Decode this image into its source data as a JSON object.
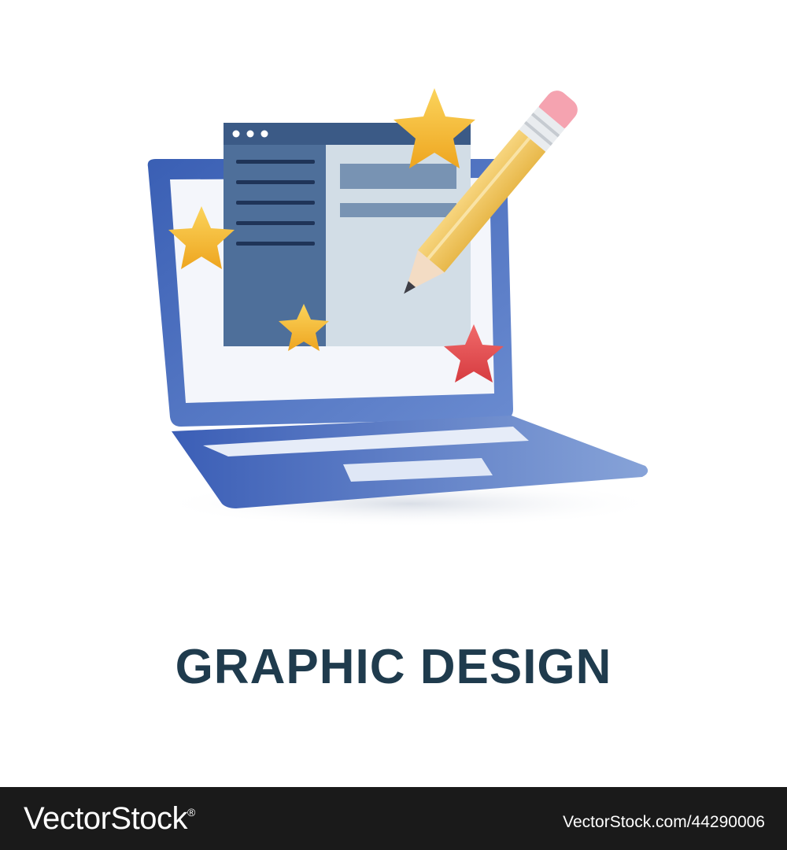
{
  "caption": {
    "title": "GRAPHIC DESIGN"
  },
  "footer": {
    "brand": "VectorStock",
    "brand_mark": "®",
    "image_ref": "VectorStock.com/44290006"
  },
  "illustration": {
    "icons": [
      "laptop-icon",
      "browser-window-icon",
      "pencil-icon",
      "star-icon"
    ],
    "colors": {
      "laptop_blue": "#3f64b8",
      "window_dark": "#4e6f9a",
      "window_light": "#d2dde6",
      "star_gold": "#f5b82e",
      "star_red": "#e0444a",
      "pencil_yellow": "#f2c865",
      "eraser_pink": "#f5a3b0",
      "text_dark": "#1f3b4d",
      "footer_bg": "#1a1a1a"
    }
  }
}
